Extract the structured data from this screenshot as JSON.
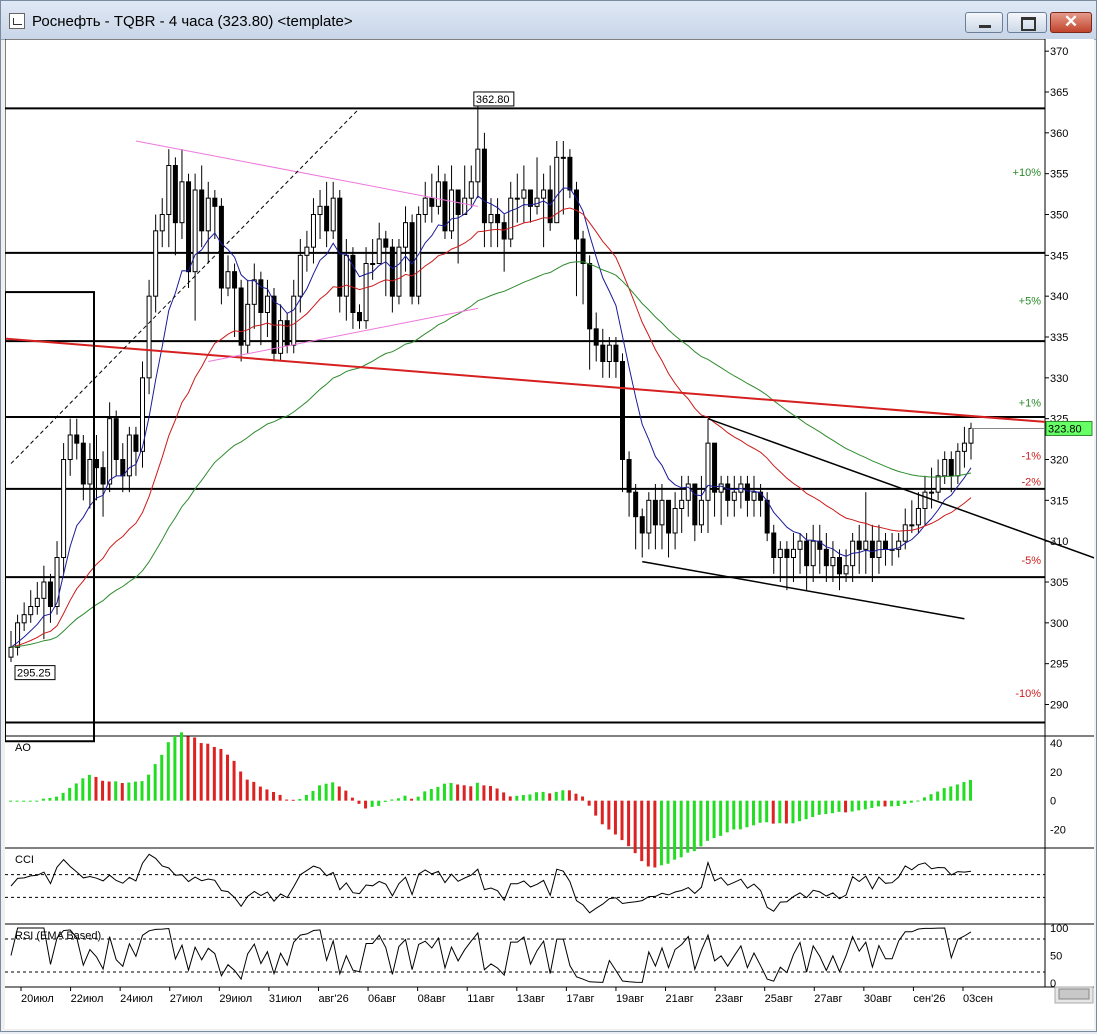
{
  "window": {
    "title": "Роснефть - TQBR - 4 часа (323.80) <template>",
    "controls": {
      "minimize_icon": "minimize-icon",
      "maximize_icon": "maximize-icon",
      "close_label": "✕"
    }
  },
  "chart_data": [
    {
      "type": "candlestick",
      "price_axis_ticks": [
        "370",
        "365",
        "360",
        "355",
        "350",
        "345",
        "340",
        "335",
        "330",
        "325",
        "320",
        "315",
        "310",
        "305",
        "300",
        "295",
        "290"
      ],
      "ylim": [
        287,
        371
      ],
      "current_price_label": "323.80",
      "high_label": "362.80",
      "low_label": "295.25",
      "percent_labels": [
        {
          "label": "+10%",
          "value": 355.2
        },
        {
          "label": "+5%",
          "value": 339.5
        },
        {
          "label": "+1%",
          "value": 327
        },
        {
          "label": "-1%",
          "value": 320.5
        },
        {
          "label": "-2%",
          "value": 317.3
        },
        {
          "label": "-5%",
          "value": 307.7
        },
        {
          "label": "-10%",
          "value": 291.4
        }
      ],
      "horizontal_levels": [
        363,
        345.3,
        334.5,
        325.2,
        316.4,
        305.6,
        287.8
      ],
      "candles": [
        [
          297,
          295.8,
          299,
          295.2
        ],
        [
          300,
          297,
          301,
          296
        ],
        [
          301,
          300,
          302.5,
          299
        ],
        [
          302,
          301,
          304,
          300
        ],
        [
          303,
          302,
          305,
          301
        ],
        [
          305,
          303,
          307,
          298
        ],
        [
          302,
          305,
          306,
          300
        ],
        [
          308,
          302,
          310,
          301
        ],
        [
          320,
          308,
          322,
          306
        ],
        [
          323,
          320,
          325,
          318
        ],
        [
          322,
          323,
          325,
          320
        ],
        [
          317,
          322,
          323,
          315
        ],
        [
          320,
          317,
          322,
          314
        ],
        [
          319,
          320,
          323,
          315
        ],
        [
          317,
          319,
          321,
          313
        ],
        [
          325,
          317,
          327,
          316
        ],
        [
          320,
          325,
          326,
          318
        ],
        [
          318,
          320,
          322,
          316
        ],
        [
          323,
          318,
          324,
          316
        ],
        [
          321,
          323,
          324,
          318
        ],
        [
          330,
          321,
          332,
          319
        ],
        [
          340,
          330,
          342,
          328
        ],
        [
          348,
          340,
          350,
          338
        ],
        [
          350,
          348,
          352,
          346
        ],
        [
          356,
          350,
          358,
          346
        ],
        [
          349,
          356,
          357,
          345
        ],
        [
          354,
          349,
          358,
          347
        ],
        [
          343,
          354,
          355,
          341
        ],
        [
          353,
          343,
          355,
          337
        ],
        [
          348,
          353,
          356,
          346
        ],
        [
          352,
          348,
          354,
          344
        ],
        [
          351,
          352,
          353,
          347
        ],
        [
          341,
          351,
          352,
          339
        ],
        [
          343,
          341,
          345,
          340
        ],
        [
          341,
          343,
          344,
          335
        ],
        [
          334,
          341,
          342,
          332
        ],
        [
          339,
          334,
          342,
          333
        ],
        [
          342,
          339,
          344,
          336
        ],
        [
          338,
          342,
          343,
          334
        ],
        [
          340,
          338,
          342,
          335
        ],
        [
          333,
          340,
          341,
          332
        ],
        [
          337,
          333,
          339,
          332
        ],
        [
          334,
          337,
          338,
          333
        ],
        [
          340,
          334,
          342,
          333
        ],
        [
          345,
          340,
          347,
          338
        ],
        [
          346,
          345,
          348,
          343
        ],
        [
          350,
          346,
          352,
          344
        ],
        [
          351,
          350,
          353,
          347
        ],
        [
          348,
          351,
          354,
          346
        ],
        [
          352,
          348,
          354,
          347
        ],
        [
          340,
          352,
          353,
          338
        ],
        [
          345,
          340,
          347,
          337
        ],
        [
          338,
          345,
          346,
          336
        ],
        [
          337,
          338,
          339,
          336
        ],
        [
          344,
          337,
          346,
          336
        ],
        [
          344,
          344,
          347,
          342
        ],
        [
          347,
          344,
          349,
          345
        ],
        [
          346,
          347,
          348,
          340
        ],
        [
          340,
          346,
          347,
          338
        ],
        [
          346,
          340,
          347,
          339
        ],
        [
          349,
          346,
          351,
          343
        ],
        [
          340,
          349,
          350,
          339
        ],
        [
          350,
          340,
          351,
          339
        ],
        [
          352,
          350,
          354,
          349
        ],
        [
          351,
          352,
          355,
          349
        ],
        [
          354,
          351,
          356,
          350
        ],
        [
          348,
          354,
          355,
          347
        ],
        [
          353,
          348,
          356,
          347
        ],
        [
          350,
          353,
          353,
          344
        ],
        [
          352,
          350,
          356,
          350
        ],
        [
          354,
          352,
          356,
          351
        ],
        [
          358,
          354,
          362.8,
          352
        ],
        [
          349,
          358,
          360,
          346
        ],
        [
          350,
          349,
          352,
          346
        ],
        [
          349,
          350,
          352,
          346
        ],
        [
          347,
          349,
          350,
          343
        ],
        [
          352,
          347,
          354,
          346
        ],
        [
          352,
          352,
          355,
          349
        ],
        [
          353,
          352,
          356,
          349
        ],
        [
          351,
          353,
          353,
          349
        ],
        [
          352,
          351,
          357,
          350
        ],
        [
          353,
          352,
          355,
          346
        ],
        [
          349,
          353,
          356,
          348
        ],
        [
          357,
          349,
          359,
          351
        ],
        [
          357,
          357,
          359,
          350
        ],
        [
          353,
          357,
          358,
          352
        ],
        [
          347,
          353,
          354,
          340
        ],
        [
          344,
          347,
          348,
          339
        ],
        [
          336,
          344,
          345,
          331
        ],
        [
          334,
          336,
          338,
          332
        ],
        [
          332,
          334,
          336,
          330
        ],
        [
          334,
          332,
          335,
          330
        ],
        [
          332,
          334,
          335,
          330
        ],
        [
          320,
          332,
          333,
          316
        ],
        [
          316,
          320,
          321,
          313
        ],
        [
          313,
          316,
          317,
          309
        ],
        [
          311,
          313,
          314,
          308
        ],
        [
          315,
          311,
          316,
          309
        ],
        [
          312,
          315,
          317,
          309
        ],
        [
          315,
          312,
          317,
          309
        ],
        [
          311,
          315,
          315,
          308
        ],
        [
          314,
          311,
          316,
          309
        ],
        [
          315,
          314,
          318,
          311
        ],
        [
          317,
          315,
          318,
          313
        ],
        [
          312,
          317,
          317,
          310
        ],
        [
          315,
          312,
          318,
          311
        ],
        [
          322,
          315,
          325,
          311
        ],
        [
          316,
          322,
          322,
          313
        ],
        [
          317,
          316,
          318,
          312
        ],
        [
          315,
          317,
          318,
          313
        ],
        [
          316,
          315,
          318,
          313
        ],
        [
          317,
          316,
          318,
          314
        ],
        [
          315,
          317,
          318,
          313
        ],
        [
          316,
          315,
          318,
          313
        ],
        [
          315,
          316,
          317,
          313
        ],
        [
          311,
          315,
          316,
          310
        ],
        [
          308,
          311,
          312,
          306
        ],
        [
          309,
          308,
          310,
          305
        ],
        [
          308,
          309,
          310,
          304
        ],
        [
          309,
          308,
          311,
          305
        ],
        [
          310,
          309,
          311,
          306
        ],
        [
          307,
          310,
          311,
          304
        ],
        [
          310,
          307,
          312,
          305
        ],
        [
          309,
          310,
          312,
          306
        ],
        [
          307,
          309,
          311,
          305
        ],
        [
          308,
          307,
          310,
          305
        ],
        [
          306,
          308,
          309,
          304
        ],
        [
          307,
          306,
          309,
          305
        ],
        [
          310,
          307,
          311,
          305
        ],
        [
          309,
          310,
          312,
          306
        ],
        [
          310,
          309,
          316,
          306
        ],
        [
          308,
          310,
          312,
          305
        ],
        [
          310,
          308,
          312,
          306
        ],
        [
          309,
          310,
          311,
          307
        ],
        [
          309,
          309,
          311,
          307
        ],
        [
          310,
          309,
          311,
          308
        ],
        [
          312,
          310,
          314,
          309
        ],
        [
          312,
          312,
          315,
          311
        ],
        [
          314,
          312,
          316,
          311
        ],
        [
          316,
          314,
          318,
          312
        ],
        [
          316,
          316,
          319,
          314
        ],
        [
          318,
          316,
          320,
          315
        ],
        [
          320,
          318,
          321,
          317
        ],
        [
          318,
          320,
          321,
          316
        ],
        [
          321,
          318,
          322,
          317
        ],
        [
          322,
          321,
          324,
          319
        ],
        [
          323.8,
          322,
          324.5,
          320
        ]
      ],
      "moving_averages": [
        {
          "color": "#1b1b9a",
          "period": 9
        },
        {
          "color": "#cc1a1a",
          "period": 26
        },
        {
          "color": "#2e8b2e",
          "period": 60
        }
      ],
      "date_labels": [
        "20июл",
        "22июл",
        "24июл",
        "27июл",
        "29июл",
        "31июл",
        "авг'26",
        "06авг",
        "08авг",
        "11авг",
        "13авг",
        "17авг",
        "19авг",
        "21авг",
        "23авг",
        "25авг",
        "27авг",
        "30авг",
        "сен'26",
        "03сен"
      ]
    },
    {
      "type": "histogram",
      "name": "AO",
      "ticks": [
        "40",
        "20",
        "0",
        "-20"
      ],
      "ylim": [
        -30,
        42
      ]
    },
    {
      "type": "line",
      "name": "CCI",
      "ylim": [
        -300,
        300
      ]
    },
    {
      "type": "line",
      "name": "RSI (EMA Based)",
      "ticks": [
        "100",
        "50",
        "0"
      ],
      "ylim": [
        0,
        100
      ]
    }
  ],
  "colors": {
    "price_label_bg": "#66ff66",
    "ao_up": "#22dd22",
    "ao_down": "#dd2222",
    "trendline_red": "#d62020",
    "trendline_pink": "#ee77dd",
    "percent_up": "#2a8a2a",
    "percent_down": "#cc2020"
  }
}
